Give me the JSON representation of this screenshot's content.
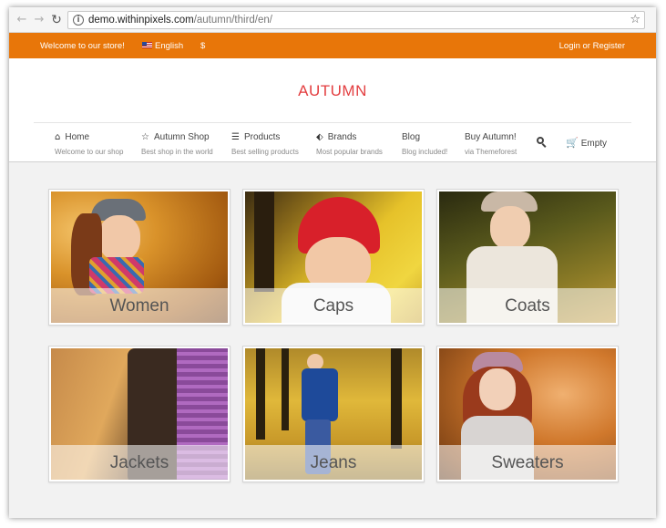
{
  "browser": {
    "url_domain": "demo.withinpixels.com",
    "url_path": "/autumn/third/en/",
    "back_icon": "←",
    "forward_icon": "→",
    "reload_icon": "↻",
    "info_icon": "i",
    "star_icon": "☆"
  },
  "topbar": {
    "welcome": "Welcome to our store!",
    "language": "English",
    "currency": "$",
    "login": "Login or Register",
    "color": "#e87609"
  },
  "header": {
    "logo": "AUTUMN",
    "logo_color": "#e33e40"
  },
  "menu": [
    {
      "title": "Home",
      "sub": "Welcome to our shop",
      "icon": "⌂"
    },
    {
      "title": "Autumn Shop",
      "sub": "Best shop in the world",
      "icon": "☆"
    },
    {
      "title": "Products",
      "sub": "Best selling products",
      "icon": "☰"
    },
    {
      "title": "Brands",
      "sub": "Most popular brands",
      "icon": "⬖"
    },
    {
      "title": "Blog",
      "sub": "Blog included!",
      "icon": ""
    },
    {
      "title": "Buy Autumn!",
      "sub": "via Themeforest",
      "icon": ""
    }
  ],
  "cart": {
    "label": "Empty",
    "icon": "🛒"
  },
  "categories": [
    {
      "label": "Women"
    },
    {
      "label": "Caps"
    },
    {
      "label": "Coats"
    },
    {
      "label": "Jackets"
    },
    {
      "label": "Jeans"
    },
    {
      "label": "Sweaters"
    }
  ]
}
